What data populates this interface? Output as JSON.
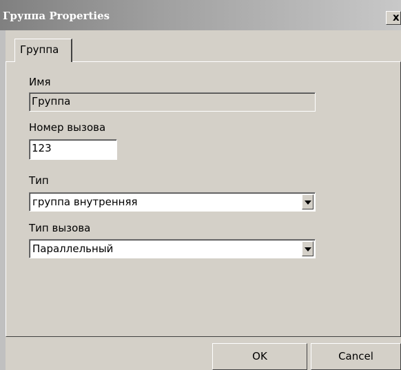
{
  "window": {
    "title": "Группа Properties",
    "close_glyph": "x"
  },
  "tabs": [
    {
      "label": "Группа",
      "selected": true
    }
  ],
  "form": {
    "name": {
      "label": "Имя",
      "value": "Группа",
      "readonly": true
    },
    "call_number": {
      "label": "Номер вызова",
      "value": "123"
    },
    "type": {
      "label": "Тип",
      "selected": "группа внутренняя"
    },
    "call_type": {
      "label": "Тип вызова",
      "selected": "Параллельный"
    }
  },
  "buttons": {
    "ok_label": "OK",
    "cancel_label": "Cancel"
  },
  "icons": {
    "close": "close-icon",
    "dropdown": "chevron-down-icon"
  },
  "colors": {
    "dialog_face": "#d4d0c8",
    "title_gradient_start": "#808080",
    "title_gradient_end": "#c8c8c8",
    "field_background": "#ffffff"
  }
}
